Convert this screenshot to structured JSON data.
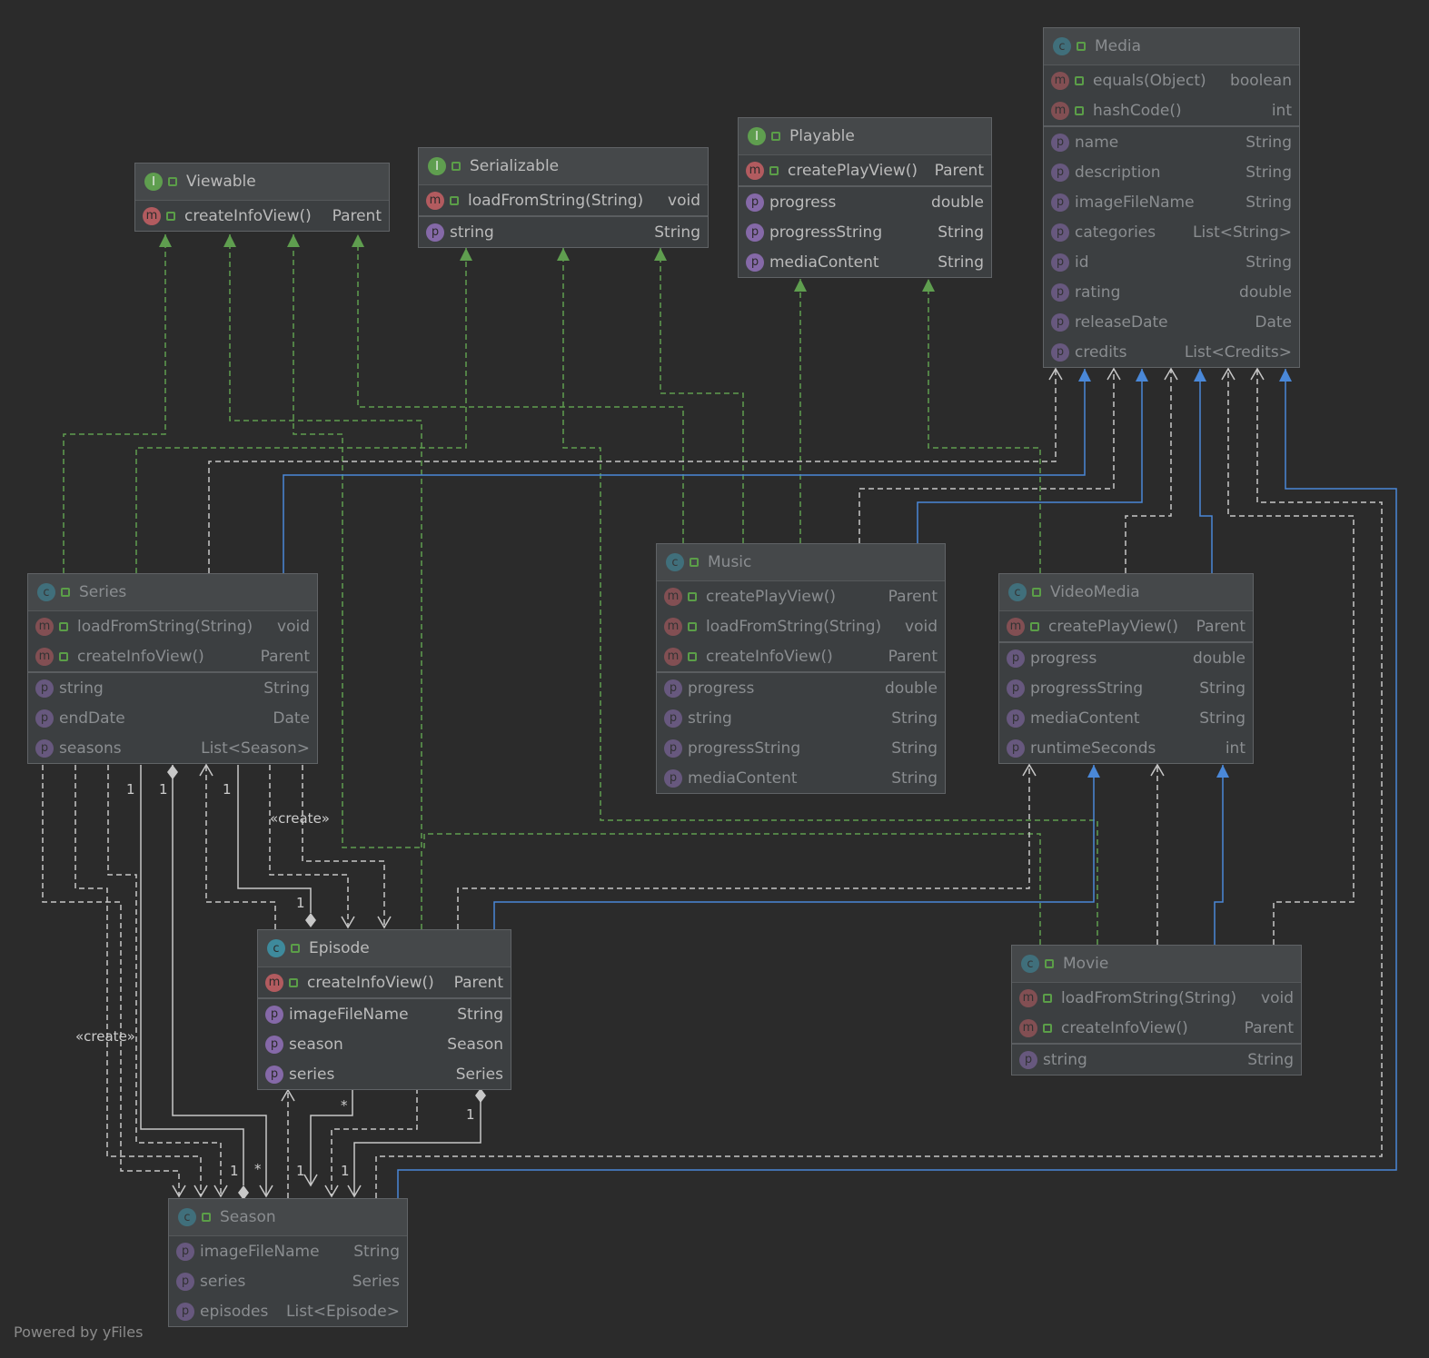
{
  "classes": [
    {
      "name": "Viewable",
      "kind": "I",
      "dim": false,
      "methods": [
        [
          "createInfoView()",
          "Parent"
        ]
      ],
      "fields": []
    },
    {
      "name": "Serializable",
      "kind": "I",
      "dim": false,
      "methods": [
        [
          "loadFromString(String)",
          "void"
        ]
      ],
      "fields": [
        [
          "string",
          "String"
        ]
      ]
    },
    {
      "name": "Playable",
      "kind": "I",
      "dim": false,
      "methods": [
        [
          "createPlayView()",
          "Parent"
        ]
      ],
      "fields": [
        [
          "progress",
          "double"
        ],
        [
          "progressString",
          "String"
        ],
        [
          "mediaContent",
          "String"
        ]
      ]
    },
    {
      "name": "Media",
      "kind": "C",
      "dim": true,
      "methods": [
        [
          "equals(Object)",
          "boolean"
        ],
        [
          "hashCode()",
          "int"
        ]
      ],
      "fields": [
        [
          "name",
          "String"
        ],
        [
          "description",
          "String"
        ],
        [
          "imageFileName",
          "String"
        ],
        [
          "categories",
          "List<String>"
        ],
        [
          "id",
          "String"
        ],
        [
          "rating",
          "double"
        ],
        [
          "releaseDate",
          "Date"
        ],
        [
          "credits",
          "List<Credits>"
        ]
      ]
    },
    {
      "name": "Series",
      "kind": "C",
      "dim": true,
      "methods": [
        [
          "loadFromString(String)",
          "void"
        ],
        [
          "createInfoView()",
          "Parent"
        ]
      ],
      "fields": [
        [
          "string",
          "String"
        ],
        [
          "endDate",
          "Date"
        ],
        [
          "seasons",
          "List<Season>"
        ]
      ]
    },
    {
      "name": "Music",
      "kind": "C",
      "dim": true,
      "methods": [
        [
          "createPlayView()",
          "Parent"
        ],
        [
          "loadFromString(String)",
          "void"
        ],
        [
          "createInfoView()",
          "Parent"
        ]
      ],
      "fields": [
        [
          "progress",
          "double"
        ],
        [
          "string",
          "String"
        ],
        [
          "progressString",
          "String"
        ],
        [
          "mediaContent",
          "String"
        ]
      ]
    },
    {
      "name": "VideoMedia",
      "kind": "C",
      "dim": true,
      "methods": [
        [
          "createPlayView()",
          "Parent"
        ]
      ],
      "fields": [
        [
          "progress",
          "double"
        ],
        [
          "progressString",
          "String"
        ],
        [
          "mediaContent",
          "String"
        ],
        [
          "runtimeSeconds",
          "int"
        ]
      ]
    },
    {
      "name": "Episode",
      "kind": "C",
      "dim": false,
      "methods": [
        [
          "createInfoView()",
          "Parent"
        ]
      ],
      "fields": [
        [
          "imageFileName",
          "String"
        ],
        [
          "season",
          "Season"
        ],
        [
          "series",
          "Series"
        ]
      ]
    },
    {
      "name": "Movie",
      "kind": "C",
      "dim": true,
      "methods": [
        [
          "loadFromString(String)",
          "void"
        ],
        [
          "createInfoView()",
          "Parent"
        ]
      ],
      "fields": [
        [
          "string",
          "String"
        ]
      ]
    },
    {
      "name": "Season",
      "kind": "C",
      "dim": true,
      "methods": [],
      "fields": [
        [
          "imageFileName",
          "String"
        ],
        [
          "series",
          "Series"
        ],
        [
          "episodes",
          "List<Episode>"
        ]
      ]
    }
  ],
  "edge_labels": [
    "1",
    "1",
    "1",
    "«create»",
    "1",
    "«create»",
    "1",
    "*",
    "1",
    "*",
    "1",
    "1"
  ],
  "colors": {
    "implements": "#5f9e4f",
    "extends": "#4a88d8",
    "dependency": "#c8c8c8"
  },
  "footer": "Powered by yFiles"
}
